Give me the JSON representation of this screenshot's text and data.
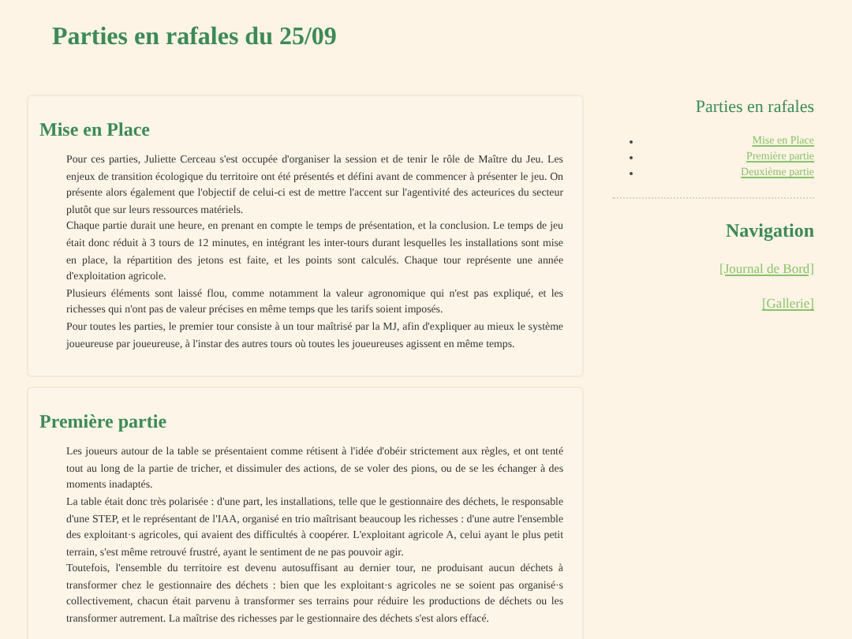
{
  "page_title": "Parties en rafales du 25/09",
  "sections": [
    {
      "heading": "Mise en Place",
      "paragraphs": [
        "Pour ces parties, Juliette Cerceau s'est occupée d'organiser la session et de tenir le rôle de Maître du Jeu. Les enjeux de transition écologique du territoire ont été présentés et défini avant de commencer à présenter le jeu. On présente alors également que l'objectif de celui-ci est de mettre l'accent sur l'agentivité des acteurices du secteur plutôt que sur leurs ressources matériels.",
        "Chaque partie durait une heure, en prenant en compte le temps de présentation, et la conclusion. Le temps de jeu était donc réduit à 3 tours de 12 minutes, en intégrant les inter-tours durant lesquelles les installations sont mise en place, la répartition des jetons est faite, et les points sont calculés. Chaque tour représente une année d'exploitation agricole.",
        "Plusieurs éléments sont laissé flou, comme notamment la valeur agronomique qui n'est pas expliqué, et les richesses qui n'ont pas de valeur précises en même temps que les tarifs soient imposés.",
        "Pour toutes les parties, le premier tour consiste à un tour maîtrisé par la MJ, afin d'expliquer au mieux le système joueureuse par joueureuse, à l'instar des autres tours où toutes les joueureuses agissent en même temps."
      ]
    },
    {
      "heading": "Première partie",
      "paragraphs": [
        "Les joueurs autour de la table se présentaient comme rétisent à l'idée d'obéir strictement aux règles, et ont tenté tout au long de la partie de tricher, et dissimuler des actions, de se voler des pions, ou de se les échanger à des moments inadaptés.",
        "La table était donc très polarisée : d'une part, les installations, telle que le gestionnaire des déchets, le responsable d'une STEP, et le représentant de l'IAA, organisé en trio maîtrisant beaucoup les richesses : d'une autre l'ensemble des exploitant·s agricoles, qui avaient des difficultés à coopérer. L'exploitant agricole A, celui ayant le plus petit terrain, s'est même retrouvé frustré, ayant le sentiment de ne pas pouvoir agir.",
        "Toutefois, l'ensemble du territoire est devenu autosuffisant au dernier tour, ne produisant aucun déchets à transformer chez le gestionnaire des déchets : bien que les exploitant·s agricoles ne se soient pas organisé·s collectivement, chacun était parvenu à transformer ses terrains pour réduire les productions de déchets ou les transformer autrement. La maîtrise des richesses par le gestionnaire des déchets s'est alors effacé."
      ]
    }
  ],
  "sidebar": {
    "toc_heading": "Parties en rafales",
    "toc_items": [
      "Mise en Place",
      "Première partie",
      "Deuxième partie"
    ],
    "nav_heading": "Navigation",
    "nav_links": [
      "[Journal de Bord]",
      "[Gallerie]"
    ]
  }
}
